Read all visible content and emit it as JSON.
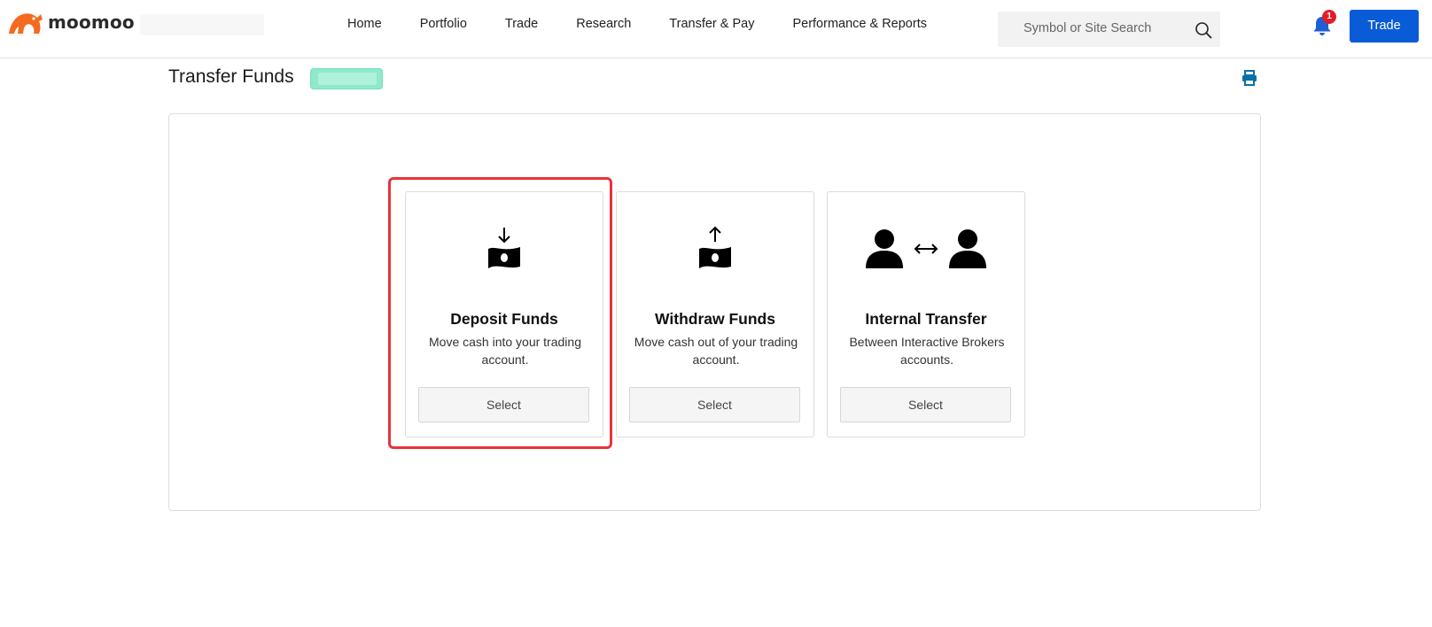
{
  "brand": {
    "name": "moomoo",
    "accent_color": "#f26b21"
  },
  "nav": {
    "items": [
      {
        "label": "Home"
      },
      {
        "label": "Portfolio"
      },
      {
        "label": "Trade"
      },
      {
        "label": "Research"
      },
      {
        "label": "Transfer & Pay"
      },
      {
        "label": "Performance & Reports"
      }
    ]
  },
  "search": {
    "placeholder": "Symbol or Site Search",
    "icon": "search-icon"
  },
  "notifications": {
    "count": "1",
    "icon": "bell-icon"
  },
  "header": {
    "trade_button": "Trade",
    "button_color": "#0a5bd7"
  },
  "page": {
    "title": "Transfer Funds",
    "print_icon": "print-icon"
  },
  "options": [
    {
      "title": "Deposit Funds",
      "description": "Move cash into your trading account.",
      "button": "Select",
      "icon": "deposit-cash-icon",
      "highlighted": true
    },
    {
      "title": "Withdraw Funds",
      "description": "Move cash out of your trading account.",
      "button": "Select",
      "icon": "withdraw-cash-icon",
      "highlighted": false
    },
    {
      "title": "Internal Transfer",
      "description": "Between Interactive Brokers accounts.",
      "button": "Select",
      "icon": "internal-transfer-icon",
      "highlighted": false
    }
  ]
}
